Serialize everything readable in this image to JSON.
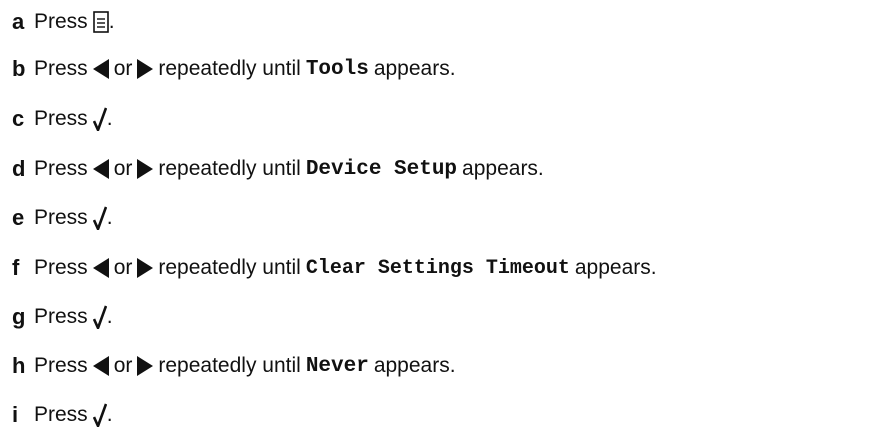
{
  "steps": [
    {
      "letter": "a",
      "press": "Press",
      "end": "."
    },
    {
      "letter": "b",
      "press": "Press",
      "or": "or",
      "until": "repeatedly until",
      "item": "Tools",
      "appears": "appears."
    },
    {
      "letter": "c",
      "press": "Press",
      "end": "."
    },
    {
      "letter": "d",
      "press": "Press",
      "or": "or",
      "until": "repeatedly until",
      "item": "Device Setup",
      "appears": "appears."
    },
    {
      "letter": "e",
      "press": "Press",
      "end": "."
    },
    {
      "letter": "f",
      "press": "Press",
      "or": "or",
      "until": "repeatedly until",
      "item": "Clear Settings Timeout",
      "appears": "appears."
    },
    {
      "letter": "g",
      "press": "Press",
      "end": "."
    },
    {
      "letter": "h",
      "press": "Press",
      "or": "or",
      "until": "repeatedly until",
      "item": "Never",
      "appears": "appears."
    },
    {
      "letter": "i",
      "press": "Press",
      "end": "."
    }
  ],
  "icons": {
    "menu": "menu-icon",
    "left": "left-arrow-icon",
    "right": "right-arrow-icon",
    "select": "checkmark-icon"
  }
}
